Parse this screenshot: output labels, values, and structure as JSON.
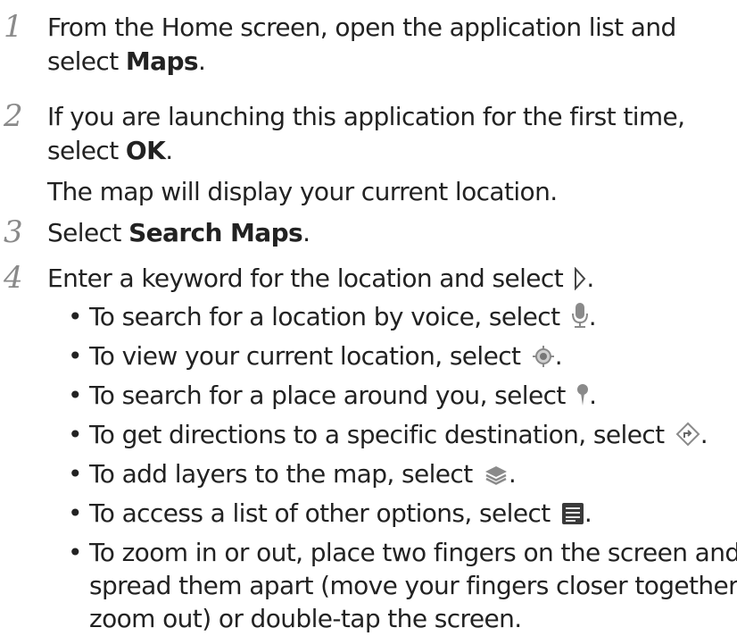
{
  "steps": [
    {
      "number": "1",
      "lines": [
        {
          "text": "From the Home screen, open the application list and"
        },
        {
          "pre": "select ",
          "bold": "Maps",
          "post": "."
        }
      ]
    },
    {
      "number": "2",
      "lines": [
        {
          "text": "If you are launching this application for the first time,"
        },
        {
          "pre": "select ",
          "bold": "OK",
          "post": "."
        },
        {
          "text": "The map will display your current location."
        }
      ]
    },
    {
      "number": "3",
      "lines": [
        {
          "pre": "Select ",
          "bold": "Search Maps",
          "post": "."
        }
      ]
    },
    {
      "number": "4",
      "lines": [
        {
          "pre": "Enter a keyword for the location and select ",
          "post": "."
        }
      ],
      "bullets": [
        {
          "text": "To search for a location by voice, select ",
          "post": "."
        },
        {
          "text": "To view your current location, select ",
          "post": "."
        },
        {
          "text": "To search for a place around you, select ",
          "post": "."
        },
        {
          "text": "To get directions to a specific destination, select ",
          "post": "."
        },
        {
          "text": "To add layers to the map, select ",
          "post": "."
        },
        {
          "text": "To access a list of other options, select ",
          "post": "."
        },
        {
          "text": "To zoom in or out, place two fingers on the screen and"
        }
      ],
      "bullet_continuation": [
        "spread them apart (move your fingers closer together to",
        "zoom out) or double-tap the screen."
      ]
    }
  ],
  "bullet_symbol": "•",
  "icons": {
    "search": "search-go-icon",
    "voice": "microphone-icon",
    "location": "my-location-icon",
    "places": "place-pin-icon",
    "directions": "directions-icon",
    "layers": "layers-icon",
    "options": "menu-icon"
  }
}
